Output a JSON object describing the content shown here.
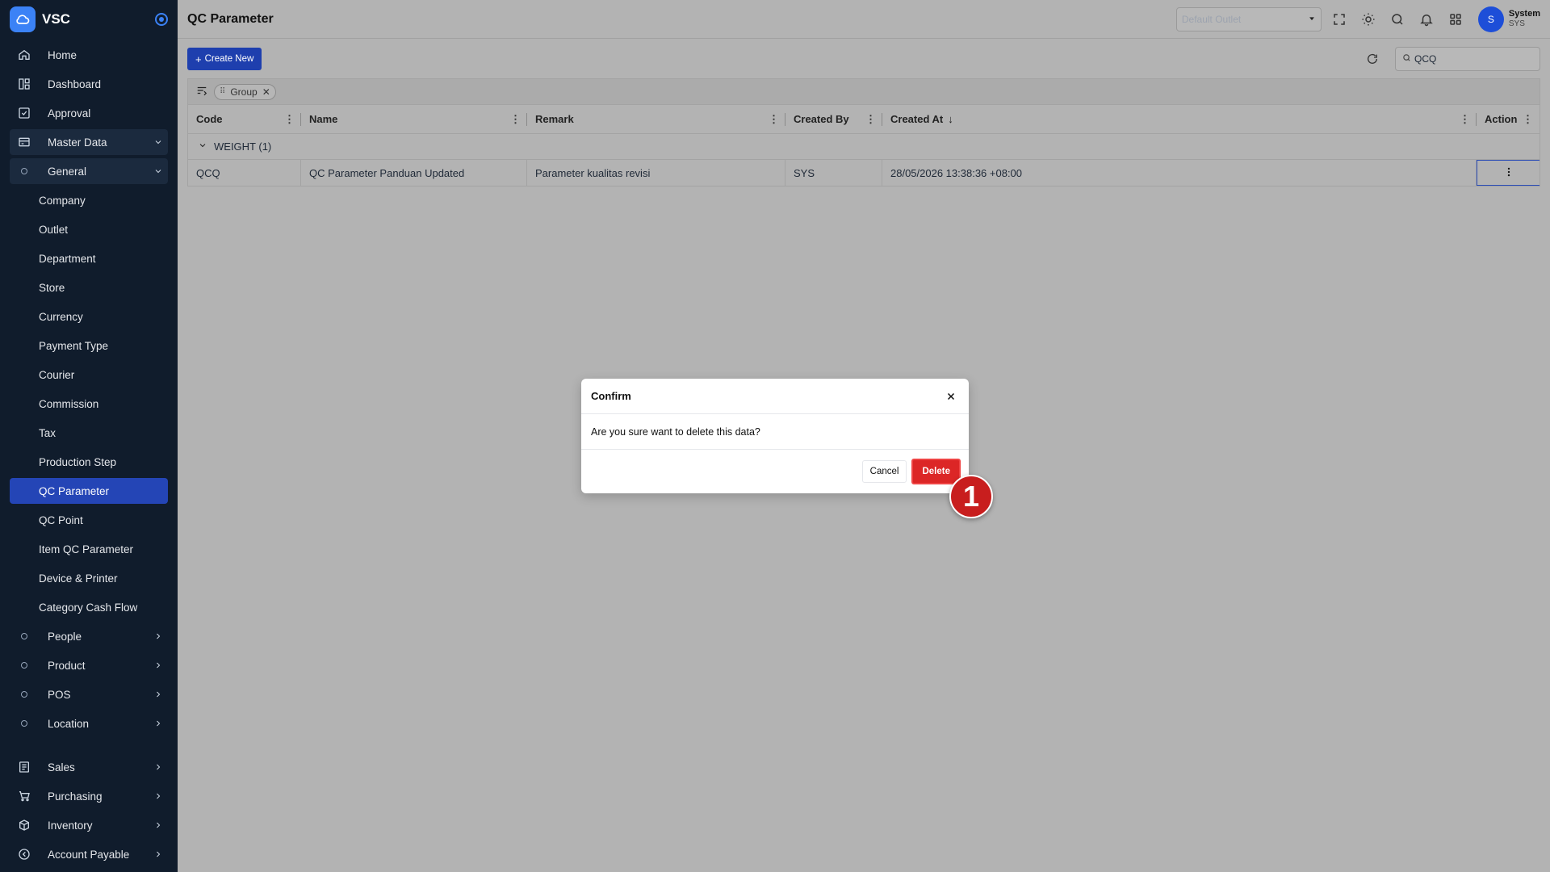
{
  "app": {
    "name": "VSC"
  },
  "sidebar": {
    "top": [
      {
        "label": "Home",
        "icon": "home-icon"
      },
      {
        "label": "Dashboard",
        "icon": "dashboard-icon"
      },
      {
        "label": "Approval",
        "icon": "approval-icon"
      },
      {
        "label": "Master Data",
        "icon": "master-data-icon"
      }
    ],
    "general": {
      "label": "General"
    },
    "general_items": [
      "Company",
      "Outlet",
      "Department",
      "Store",
      "Currency",
      "Payment Type",
      "Courier",
      "Commission",
      "Tax",
      "Production Step",
      "QC Parameter",
      "QC Point",
      "Item QC Parameter",
      "Device & Printer",
      "Category Cash Flow"
    ],
    "active_item": "QC Parameter",
    "master_groups": [
      "People",
      "Product",
      "POS",
      "Location"
    ],
    "bottom": [
      {
        "label": "Sales",
        "icon": "sales-icon"
      },
      {
        "label": "Purchasing",
        "icon": "cart-icon"
      },
      {
        "label": "Inventory",
        "icon": "box-icon"
      },
      {
        "label": "Account Payable",
        "icon": "account-payable-icon"
      }
    ]
  },
  "header": {
    "title": "QC Parameter",
    "outlet_placeholder": "Default Outlet",
    "user": {
      "initial": "S",
      "name": "System",
      "code": "SYS"
    }
  },
  "toolbar": {
    "create_label": "Create New",
    "search_value": "QCQ"
  },
  "grid": {
    "group_chip": "Group",
    "columns": [
      "Code",
      "Name",
      "Remark",
      "Created By",
      "Created At",
      "Action"
    ],
    "group_label": "WEIGHT (1)",
    "rows": [
      {
        "code": "QCQ",
        "name": "QC Parameter Panduan Updated",
        "remark": "Parameter kualitas revisi",
        "created_by": "SYS",
        "created_at": "28/05/2026 13:38:36 +08:00"
      }
    ]
  },
  "modal": {
    "title": "Confirm",
    "message": "Are you sure want to delete this data?",
    "cancel_label": "Cancel",
    "delete_label": "Delete"
  },
  "marker": {
    "label": "1",
    "color": "#c81e1e"
  },
  "colors": {
    "sidebar_bg": "#101c2c",
    "active": "#2445b6",
    "primary": "#1e3fae",
    "danger": "#dc2626"
  }
}
